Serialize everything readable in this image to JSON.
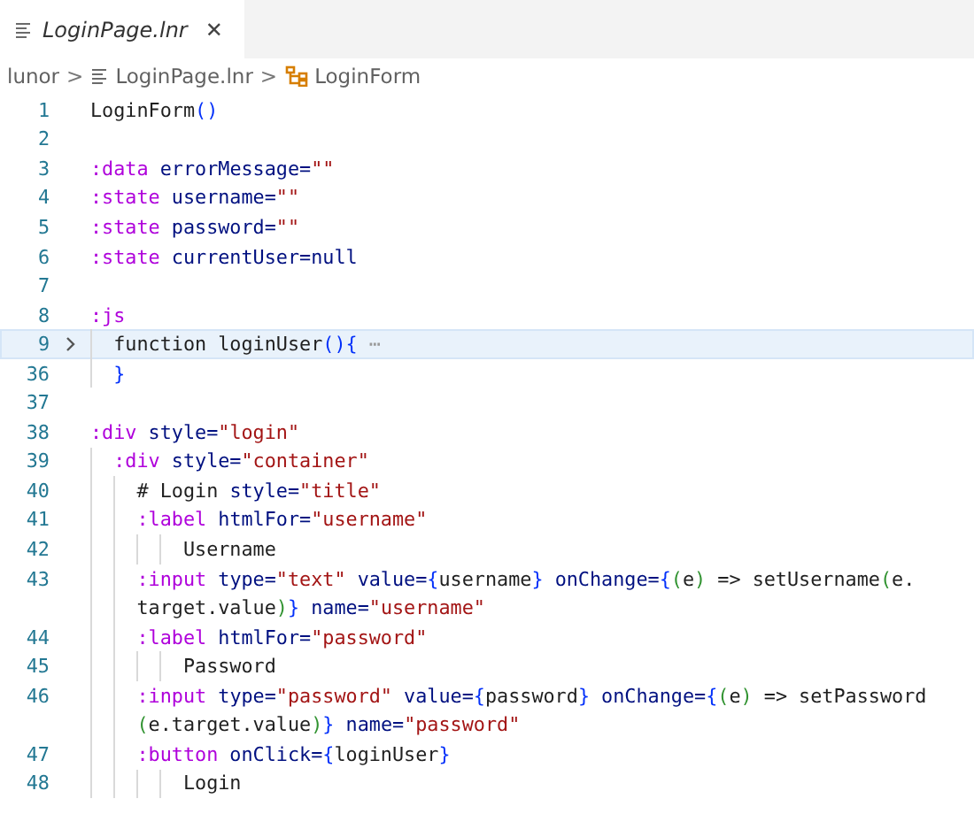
{
  "tab": {
    "label": "LoginPage.lnr",
    "close": "✕"
  },
  "breadcrumb": {
    "folder": "lunor",
    "file": "LoginPage.lnr",
    "symbol": "LoginForm",
    "separator": ">"
  },
  "rows": [
    {
      "number": "1",
      "tokens": [
        {
          "text": "LoginForm",
          "kind": "text"
        },
        {
          "text": "()",
          "kind": "bracket"
        }
      ]
    },
    {
      "number": "2",
      "tokens": []
    },
    {
      "number": "3",
      "tokens": [
        {
          "text": ":data",
          "kind": "keyword"
        },
        {
          "text": " errorMessage=",
          "kind": "attr"
        },
        {
          "text": "\"\"",
          "kind": "string"
        }
      ]
    },
    {
      "number": "4",
      "tokens": [
        {
          "text": ":state",
          "kind": "keyword"
        },
        {
          "text": " username=",
          "kind": "attr"
        },
        {
          "text": "\"\"",
          "kind": "string"
        }
      ]
    },
    {
      "number": "5",
      "tokens": [
        {
          "text": ":state",
          "kind": "keyword"
        },
        {
          "text": " password=",
          "kind": "attr"
        },
        {
          "text": "\"\"",
          "kind": "string"
        }
      ]
    },
    {
      "number": "6",
      "tokens": [
        {
          "text": ":state",
          "kind": "keyword"
        },
        {
          "text": " currentUser=null",
          "kind": "attr"
        }
      ]
    },
    {
      "number": "7",
      "tokens": []
    },
    {
      "number": "8",
      "tokens": [
        {
          "text": ":js",
          "kind": "keyword"
        }
      ]
    },
    {
      "number": "9",
      "folded": true,
      "current": true,
      "tokens": [
        {
          "text": "  function loginUser",
          "kind": "text"
        },
        {
          "text": "(){",
          "kind": "bracket"
        },
        {
          "text": " ⋯",
          "kind": "muted"
        }
      ]
    },
    {
      "number": "36",
      "tokens": [
        {
          "text": "  }",
          "kind": "bracket"
        }
      ]
    },
    {
      "number": "37",
      "tokens": []
    },
    {
      "number": "38",
      "tokens": [
        {
          "text": ":div",
          "kind": "keyword"
        },
        {
          "text": " style=",
          "kind": "attr"
        },
        {
          "text": "\"login\"",
          "kind": "string"
        }
      ]
    },
    {
      "number": "39",
      "tokens": [
        {
          "text": "  :div",
          "kind": "keyword"
        },
        {
          "text": " style=",
          "kind": "attr"
        },
        {
          "text": "\"container\"",
          "kind": "string"
        }
      ]
    },
    {
      "number": "40",
      "tokens": [
        {
          "text": "    # Login ",
          "kind": "text"
        },
        {
          "text": "style=",
          "kind": "attr"
        },
        {
          "text": "\"title\"",
          "kind": "string"
        }
      ]
    },
    {
      "number": "41",
      "tokens": [
        {
          "text": "    :label",
          "kind": "keyword"
        },
        {
          "text": " htmlFor=",
          "kind": "attr"
        },
        {
          "text": "\"username\"",
          "kind": "string"
        }
      ]
    },
    {
      "number": "42",
      "tokens": [
        {
          "text": "        Username",
          "kind": "text"
        }
      ]
    },
    {
      "number": "43",
      "tokens": [
        {
          "text": "    :input",
          "kind": "keyword"
        },
        {
          "text": " type=",
          "kind": "attr"
        },
        {
          "text": "\"text\"",
          "kind": "string"
        },
        {
          "text": " value=",
          "kind": "attr"
        },
        {
          "text": "{",
          "kind": "bracket"
        },
        {
          "text": "username",
          "kind": "text"
        },
        {
          "text": "}",
          "kind": "bracket"
        },
        {
          "text": " onChange=",
          "kind": "attr"
        },
        {
          "text": "{",
          "kind": "bracket"
        },
        {
          "text": "(",
          "kind": "paren"
        },
        {
          "text": "e",
          "kind": "text"
        },
        {
          "text": ")",
          "kind": "paren"
        },
        {
          "text": " => setUsername",
          "kind": "text"
        },
        {
          "text": "(",
          "kind": "paren"
        },
        {
          "text": "e.",
          "kind": "text"
        }
      ]
    },
    {
      "tokens": [
        {
          "text": "    target.value",
          "kind": "text"
        },
        {
          "text": ")",
          "kind": "paren"
        },
        {
          "text": "}",
          "kind": "bracket"
        },
        {
          "text": " name=",
          "kind": "attr"
        },
        {
          "text": "\"username\"",
          "kind": "string"
        }
      ]
    },
    {
      "number": "44",
      "tokens": [
        {
          "text": "    :label",
          "kind": "keyword"
        },
        {
          "text": " htmlFor=",
          "kind": "attr"
        },
        {
          "text": "\"password\"",
          "kind": "string"
        }
      ]
    },
    {
      "number": "45",
      "tokens": [
        {
          "text": "        Password",
          "kind": "text"
        }
      ]
    },
    {
      "number": "46",
      "tokens": [
        {
          "text": "    :input",
          "kind": "keyword"
        },
        {
          "text": " type=",
          "kind": "attr"
        },
        {
          "text": "\"password\"",
          "kind": "string"
        },
        {
          "text": " value=",
          "kind": "attr"
        },
        {
          "text": "{",
          "kind": "bracket"
        },
        {
          "text": "password",
          "kind": "text"
        },
        {
          "text": "}",
          "kind": "bracket"
        },
        {
          "text": " onChange=",
          "kind": "attr"
        },
        {
          "text": "{",
          "kind": "bracket"
        },
        {
          "text": "(",
          "kind": "paren"
        },
        {
          "text": "e",
          "kind": "text"
        },
        {
          "text": ")",
          "kind": "paren"
        },
        {
          "text": " => setPassword",
          "kind": "text"
        }
      ]
    },
    {
      "tokens": [
        {
          "text": "    (",
          "kind": "paren"
        },
        {
          "text": "e.target.value",
          "kind": "text"
        },
        {
          "text": ")",
          "kind": "paren"
        },
        {
          "text": "}",
          "kind": "bracket"
        },
        {
          "text": " name=",
          "kind": "attr"
        },
        {
          "text": "\"password\"",
          "kind": "string"
        }
      ]
    },
    {
      "number": "47",
      "tokens": [
        {
          "text": "    :button",
          "kind": "keyword"
        },
        {
          "text": " onClick=",
          "kind": "attr"
        },
        {
          "text": "{",
          "kind": "bracket"
        },
        {
          "text": "loginUser",
          "kind": "text"
        },
        {
          "text": "}",
          "kind": "bracket"
        }
      ]
    },
    {
      "number": "48",
      "tokens": [
        {
          "text": "        Login",
          "kind": "text"
        }
      ]
    }
  ]
}
